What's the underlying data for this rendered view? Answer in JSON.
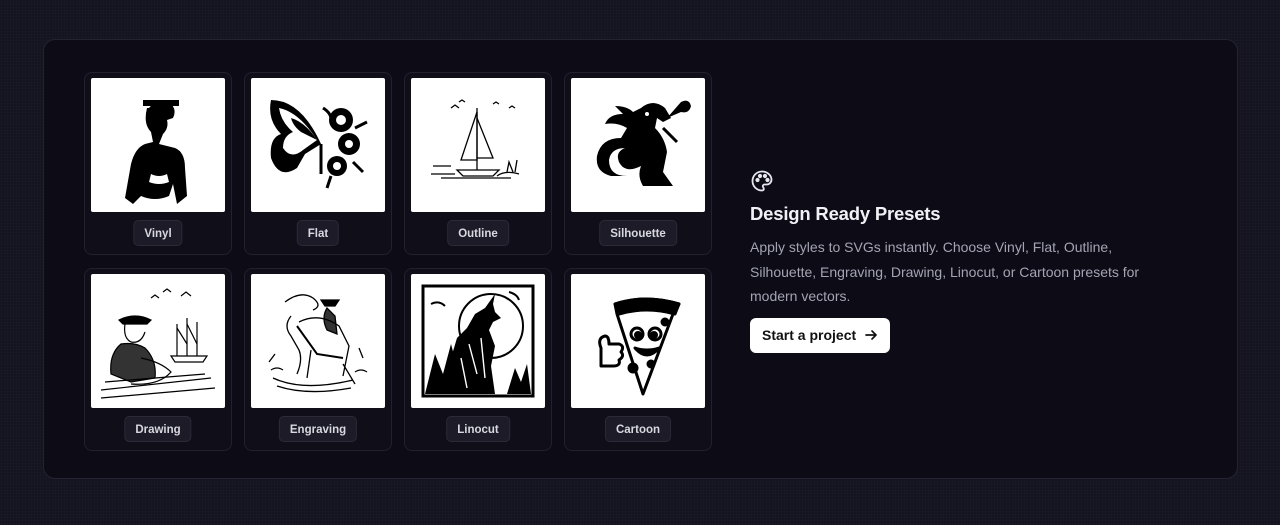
{
  "presets": [
    {
      "label": "Vinyl",
      "icon": "woman-portrait-illustration"
    },
    {
      "label": "Flat",
      "icon": "butterfly-flowers-illustration"
    },
    {
      "label": "Outline",
      "icon": "sailboat-illustration"
    },
    {
      "label": "Silhouette",
      "icon": "dragon-illustration"
    },
    {
      "label": "Drawing",
      "icon": "fisherman-illustration"
    },
    {
      "label": "Engraving",
      "icon": "cowboy-horse-illustration"
    },
    {
      "label": "Linocut",
      "icon": "howling-wolf-illustration"
    },
    {
      "label": "Cartoon",
      "icon": "pizza-slice-illustration"
    }
  ],
  "info": {
    "icon": "palette-icon",
    "title": "Design Ready Presets",
    "description": "Apply styles to SVGs instantly. Choose Vinyl, Flat, Outline, Silhouette, Engraving, Drawing, Linocut, or Cartoon presets for modern vectors.",
    "cta_label": "Start a project",
    "cta_icon": "arrow-right-icon"
  }
}
